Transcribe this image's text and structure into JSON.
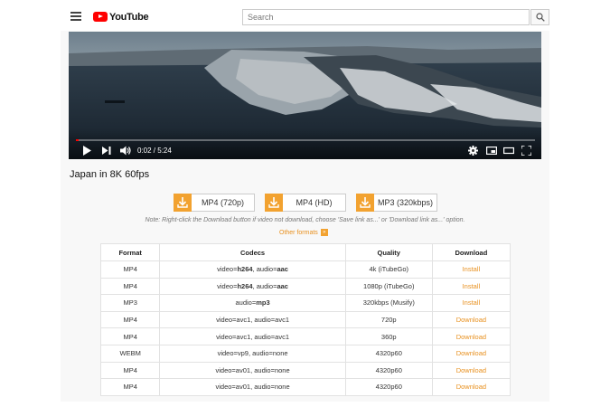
{
  "header": {
    "logo_text": "YouTube",
    "search_placeholder": "Search"
  },
  "player": {
    "time_current": "0:02",
    "time_separator": " / ",
    "time_total": "5:24",
    "progress_fraction": 0.006
  },
  "video_title": "Japan in 8K 60fps",
  "download_buttons": [
    {
      "label": "MP4 (720p)"
    },
    {
      "label": "MP4 (HD)"
    },
    {
      "label": "MP3 (320kbps)"
    }
  ],
  "note": "Note: Right-click the Download button if video not download, choose 'Save link as...' or 'Download link as...' option.",
  "other_formats": "Other formats",
  "table": {
    "headers": [
      "Format",
      "Codecs",
      "Quality",
      "Download"
    ],
    "rows": [
      {
        "format": "MP4",
        "codec_video": "video=",
        "codec_video_bold": "h264",
        "codec_audio": ", audio=",
        "codec_audio_bold": "aac",
        "quality": "4k (iTubeGo)",
        "action": "Install"
      },
      {
        "format": "MP4",
        "codec_video": "video=",
        "codec_video_bold": "h264",
        "codec_audio": ", audio=",
        "codec_audio_bold": "aac",
        "quality": "1080p (iTubeGo)",
        "action": "Install"
      },
      {
        "format": "MP3",
        "codec_video": "",
        "codec_video_bold": "",
        "codec_audio": "audio=",
        "codec_audio_bold": "mp3",
        "quality": "320kbps (Musify)",
        "action": "Install"
      },
      {
        "format": "MP4",
        "codec_video": "video=avc1",
        "codec_video_bold": "",
        "codec_audio": ", audio=avc1",
        "codec_audio_bold": "",
        "quality": "720p",
        "action": "Download"
      },
      {
        "format": "MP4",
        "codec_video": "video=avc1",
        "codec_video_bold": "",
        "codec_audio": ", audio=avc1",
        "codec_audio_bold": "",
        "quality": "360p",
        "action": "Download"
      },
      {
        "format": "WEBM",
        "codec_video": "video=vp9",
        "codec_video_bold": "",
        "codec_audio": ", audio=none",
        "codec_audio_bold": "",
        "quality": "4320p60",
        "action": "Download"
      },
      {
        "format": "MP4",
        "codec_video": "video=av01",
        "codec_video_bold": "",
        "codec_audio": ", audio=none",
        "codec_audio_bold": "",
        "quality": "4320p60",
        "action": "Download"
      },
      {
        "format": "MP4",
        "codec_video": "video=av01",
        "codec_video_bold": "",
        "codec_audio": ", audio=none",
        "codec_audio_bold": "",
        "quality": "4320p60",
        "action": "Download"
      }
    ]
  },
  "colors": {
    "accent_orange": "#f2a230",
    "link_orange": "#e8901e",
    "youtube_red": "#ff0000"
  },
  "icons": [
    "menu-icon",
    "youtube-logo-icon",
    "search-icon",
    "play-icon",
    "next-icon",
    "volume-icon",
    "settings-icon",
    "miniplayer-icon",
    "theater-icon",
    "fullscreen-icon",
    "download-arrow-icon",
    "double-chevron-icon"
  ]
}
